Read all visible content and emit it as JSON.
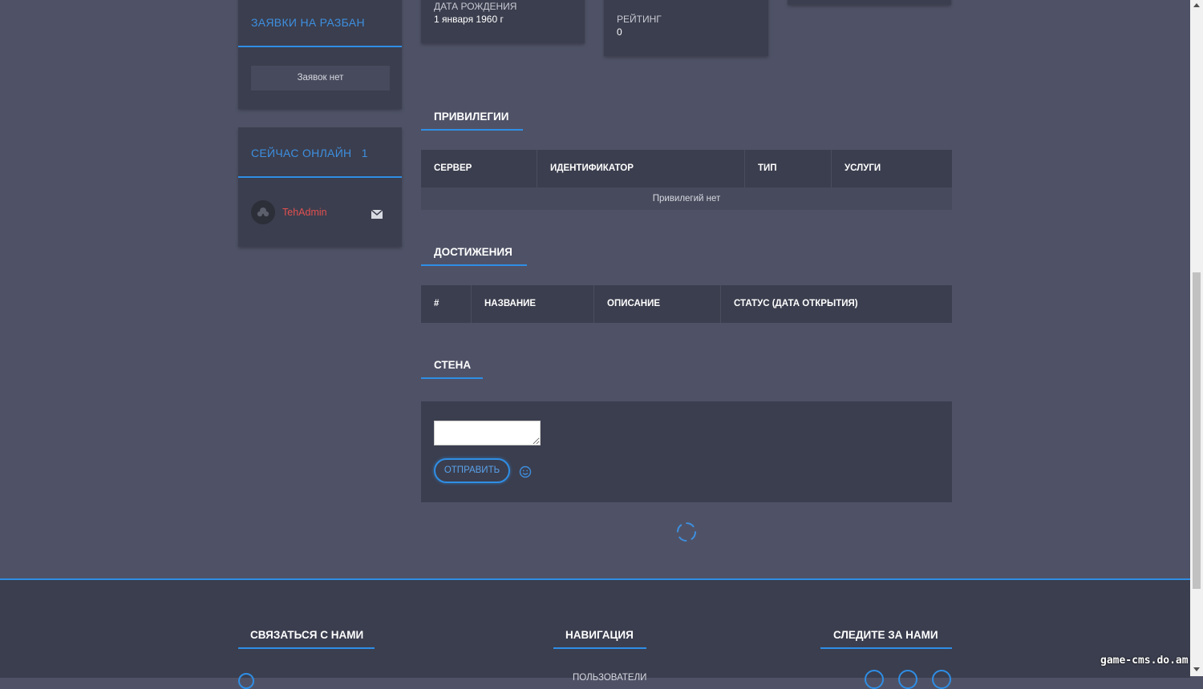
{
  "sidebar": {
    "ban_requests": {
      "title": "ЗАЯВКИ НА РАЗБАН",
      "empty_text": "Заявок нет"
    },
    "online": {
      "title": "СЕЙЧАС ОНЛАЙН",
      "count": "1",
      "user": "TehAdmin"
    }
  },
  "profile": {
    "birth_label": "ДАТА РОЖДЕНИЯ",
    "birth_value": "1 января 1960 г",
    "rating_label": "РЕЙТИНГ",
    "rating_value": "0"
  },
  "privileges": {
    "title": "ПРИВИЛЕГИИ",
    "columns": [
      "СЕРВЕР",
      "ИДЕНТИФИКАТОР",
      "ТИП",
      "УСЛУГИ"
    ],
    "empty_text": "Привилегий нет"
  },
  "achievements": {
    "title": "ДОСТИЖЕНИЯ",
    "columns": [
      "#",
      "НАЗВАНИЕ",
      "ОПИСАНИЕ",
      "СТАТУС (ДАТА ОТКРЫТИЯ)"
    ]
  },
  "wall": {
    "title": "СТЕНА",
    "textarea_value": "",
    "send_label": "ОТПРАВИТЬ"
  },
  "footer": {
    "contact_title": "СВЯЗАТЬСЯ С НАМИ",
    "nav_title": "НАВИГАЦИЯ",
    "nav_first_item": "ПОЛЬЗОВАТЕЛИ",
    "follow_title": "СЛЕДИТЕ ЗА НАМИ"
  },
  "watermark": "game-cms.do.am",
  "colors": {
    "accent": "#2f8ee6",
    "background": "#4f5266",
    "card": "#3b3e4e",
    "username": "#e05050"
  }
}
